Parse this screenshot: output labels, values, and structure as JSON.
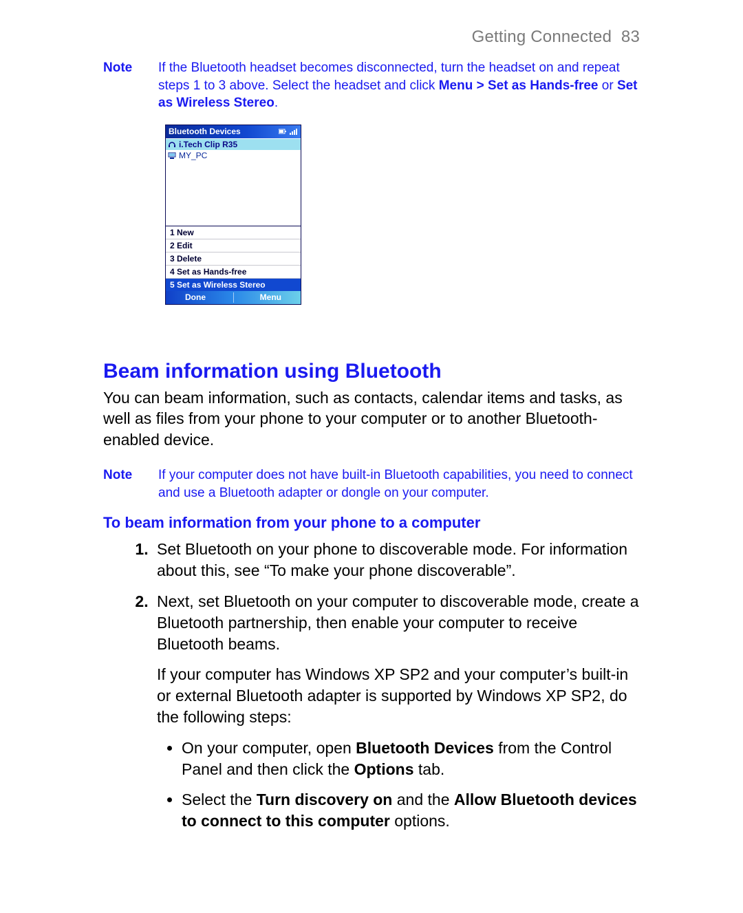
{
  "header": {
    "section": "Getting Connected",
    "page_no": "83"
  },
  "note1": {
    "label": "Note",
    "t1": "If the Bluetooth headset becomes disconnected, turn the headset on and repeat steps 1 to 3 above. Select the headset and click ",
    "b1": "Menu > Set as Hands-free",
    "t2": " or ",
    "b2": "Set as Wireless Stereo",
    "t3": "."
  },
  "phone": {
    "title": "Bluetooth Devices",
    "items": [
      {
        "label": "i.Tech Clip R35",
        "selected": true,
        "icon": "headset-icon"
      },
      {
        "label": "MY_PC",
        "selected": false,
        "icon": "computer-icon"
      }
    ],
    "menu": [
      {
        "label": "1 New"
      },
      {
        "label": "2 Edit"
      },
      {
        "label": "3 Delete"
      },
      {
        "label": "4 Set as Hands-free"
      },
      {
        "label": "5 Set as Wireless Stereo",
        "selected": true
      }
    ],
    "soft_left": "Done",
    "soft_right": "Menu"
  },
  "section": {
    "title": "Beam information using Bluetooth",
    "intro": "You can beam information, such as contacts, calendar items and tasks, as well as files from your phone to your computer or to another Bluetooth-enabled device."
  },
  "note2": {
    "label": "Note",
    "text": "If your computer does not have built-in Bluetooth capabilities, you need to connect and use a Bluetooth adapter or dongle on your computer."
  },
  "howto": {
    "title": "To beam information from your phone to a computer",
    "step1": "Set Bluetooth on your phone to discoverable mode. For information about this, see “To make your phone discoverable”.",
    "step2": "Next, set Bluetooth on your computer to discoverable mode, create a Bluetooth partnership, then enable your computer to receive Bluetooth beams.",
    "step2b": "If your computer has Windows XP SP2 and your computer’s built-in or external Bluetooth adapter is supported by Windows XP SP2, do the following steps:",
    "bul1_a": "On your computer, open ",
    "bul1_b1": "Bluetooth Devices",
    "bul1_c": " from the Control Panel and then click the ",
    "bul1_b2": "Options",
    "bul1_d": " tab.",
    "bul2_a": "Select the ",
    "bul2_b1": "Turn discovery on",
    "bul2_c": " and the ",
    "bul2_b2": "Allow Bluetooth devices to connect to this computer",
    "bul2_d": " options."
  }
}
